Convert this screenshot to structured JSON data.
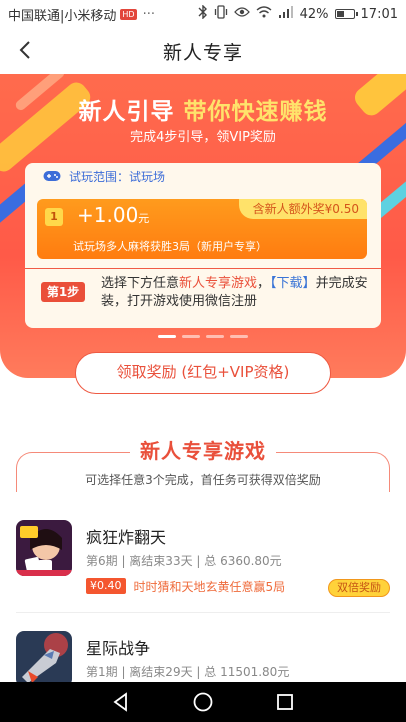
{
  "status_bar": {
    "carrier": "中国联通|小米移动",
    "hd_badge": "HD",
    "dots": "···",
    "battery": "42%",
    "time": "17:01"
  },
  "header": {
    "title": "新人专享"
  },
  "hero": {
    "title_main": "新人引导",
    "title_highlight": "带你快速赚钱",
    "subtitle": "完成4步引导，领VIP奖励",
    "trial_scope": "试玩范围：试玩场",
    "reward_index": "1",
    "reward_amount": "+1.00",
    "reward_unit": "元",
    "reward_desc": "试玩场多人麻将获胜3局（新用户专享）",
    "extra_bonus": "含新人额外奖¥0.50",
    "step_label": "第1步",
    "step_text_a": "选择下方任意",
    "step_text_b": "新人专享游戏",
    "step_text_c": "，",
    "step_text_d": "【下载】",
    "step_text_e": "并完成安装，打开游戏使用微信注册"
  },
  "claim_button": "领取奖励 (红包+VIP资格)",
  "section": {
    "title": "新人专享游戏",
    "subtitle": "可选择任意3个完成，首任务可获得双倍奖励"
  },
  "games": [
    {
      "name": "疯狂炸翻天",
      "meta": "第6期 | 离结束33天 | 总 6360.80元",
      "money": "¥0.40",
      "task": "时时猜和天地玄黄任意赢5局",
      "badge": "双倍奖励"
    },
    {
      "name": "星际战争",
      "meta": "第1期 | 离结束29天 | 总 11501.80元"
    }
  ],
  "colors": {
    "brand_red": "#e9503b",
    "hero_top": "#ff6b4d",
    "orange": "#ff8a17",
    "yellow": "#ffe26a",
    "link_blue": "#3a74d6"
  },
  "icons": {
    "back": "chevron-left-icon",
    "gamepad": "gamepad-icon",
    "nav_back": "triangle-back-icon",
    "nav_home": "circle-home-icon",
    "nav_recent": "square-recent-icon"
  }
}
